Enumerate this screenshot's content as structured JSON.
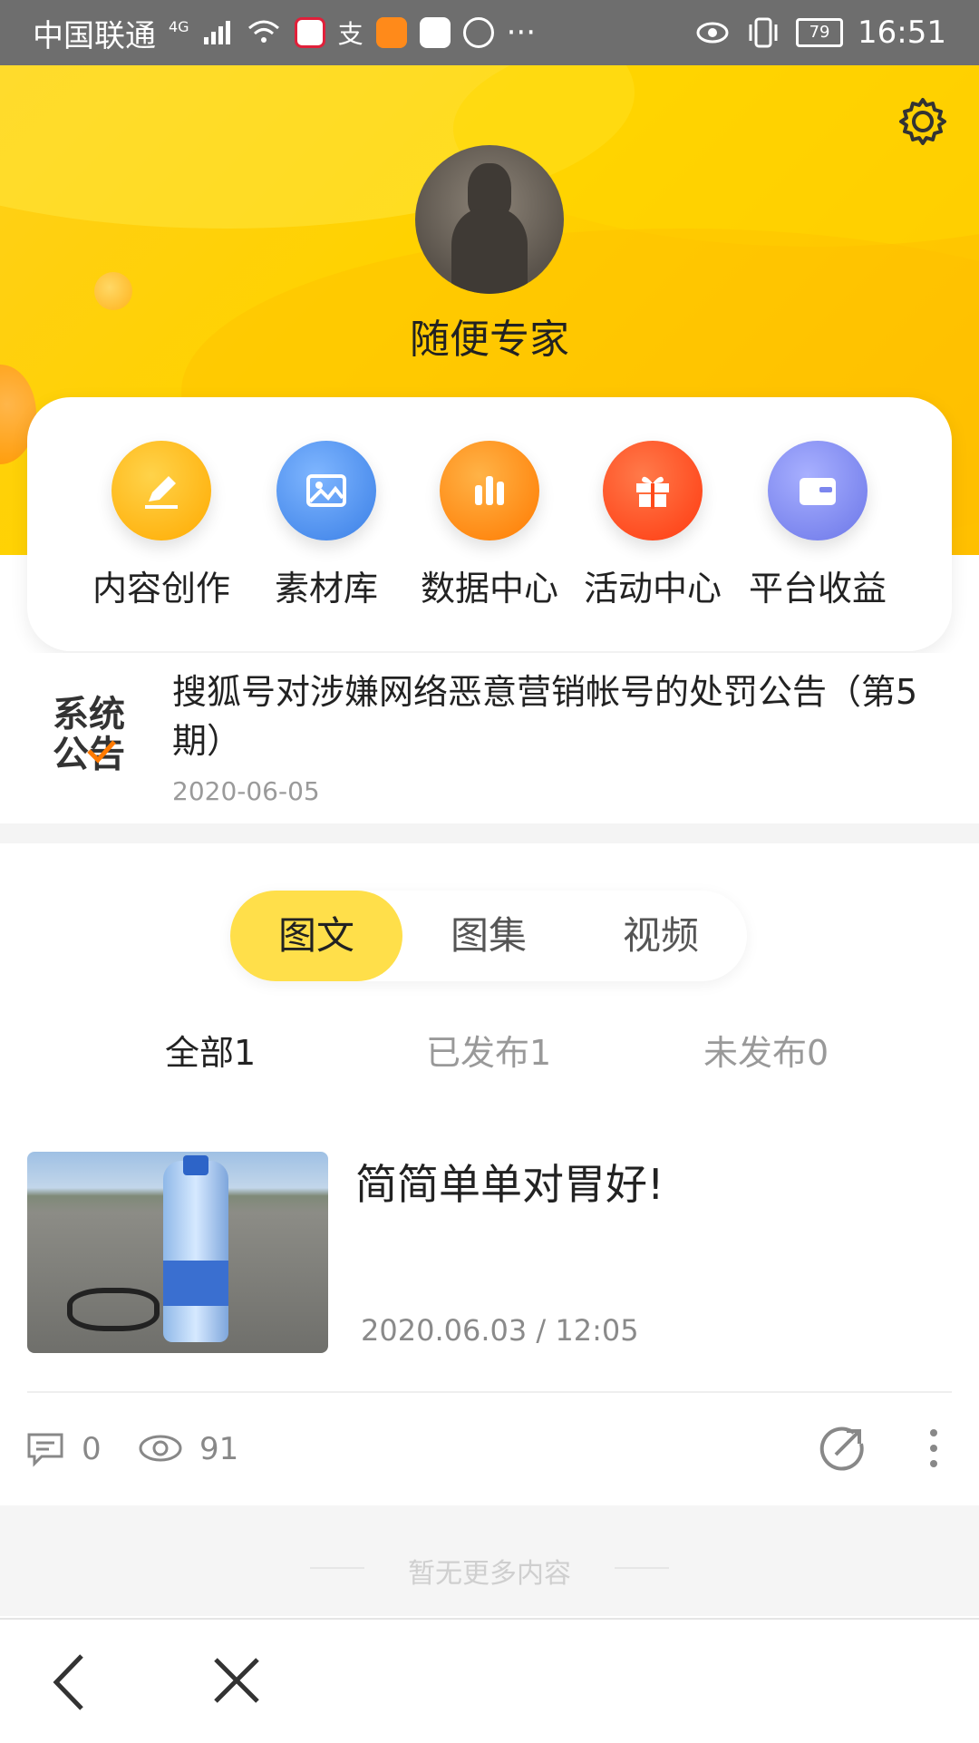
{
  "status_bar": {
    "carrier": "中国联通",
    "network": "4G",
    "more": "···",
    "battery": "79",
    "time": "16:51"
  },
  "profile": {
    "username": "随便专家"
  },
  "functions": [
    {
      "label": "内容创作",
      "icon": "pencil-icon",
      "color": "#ffb100"
    },
    {
      "label": "素材库",
      "icon": "image-icon",
      "color": "#3f86e8"
    },
    {
      "label": "数据中心",
      "icon": "bar-chart-icon",
      "color": "#ff8a00"
    },
    {
      "label": "活动中心",
      "icon": "gift-icon",
      "color": "#ff4a1a"
    },
    {
      "label": "平台收益",
      "icon": "wallet-icon",
      "color": "#7c86ee"
    }
  ],
  "notice": {
    "logo_line1": "系统",
    "logo_line2": "公告",
    "title": "搜狐号对涉嫌网络恶意营销帐号的处罚公告（第5期）",
    "date": "2020-06-05"
  },
  "content_types": {
    "tabs": [
      "图文",
      "图集",
      "视频"
    ],
    "active": "图文"
  },
  "filters": {
    "all": "全部1",
    "published": "已发布1",
    "unpublished": "未发布0"
  },
  "post": {
    "title": "简简单单对胃好!",
    "datetime": "2020.06.03 / 12:05",
    "comments": "0",
    "views": "91"
  },
  "footer_text": "暂无更多内容",
  "colors": {
    "accent": "#ffd200",
    "active_tab": "#ffdf4a",
    "status_bar": "#6e6e6e"
  }
}
